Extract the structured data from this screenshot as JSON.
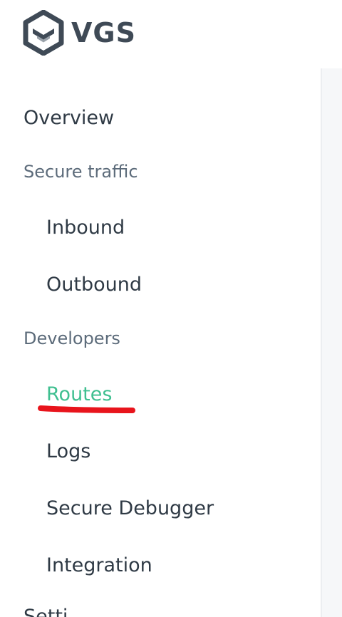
{
  "brand": {
    "name": "VGS"
  },
  "colors": {
    "text_primary": "#2f3a45",
    "text_section": "#5c6b7a",
    "active": "#3fbf90",
    "annotation_red": "#e8141c",
    "logo": "#3f4a56"
  },
  "nav": {
    "overview": "Overview",
    "secure_traffic": {
      "label": "Secure traffic",
      "items": [
        "Inbound",
        "Outbound"
      ]
    },
    "developers": {
      "label": "Developers",
      "items": [
        "Routes",
        "Logs",
        "Secure Debugger",
        "Integration"
      ],
      "active": "Routes"
    },
    "settings_partial": "Setti"
  }
}
